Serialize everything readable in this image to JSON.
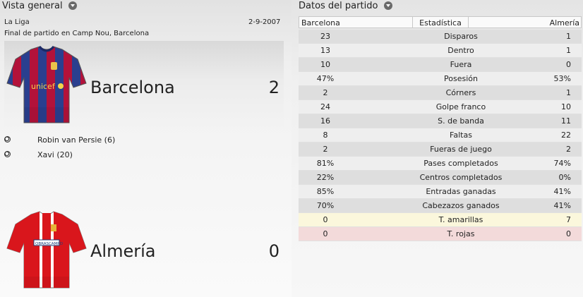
{
  "overview": {
    "header": "Vista general",
    "competition": "La Liga",
    "date": "2-9-2007",
    "venue_line": "Final de partido en Camp Nou, Barcelona",
    "home": {
      "name": "Barcelona",
      "score": "2",
      "kit_sponsor": "unicef",
      "scorers": [
        "Robin van Persie (6)",
        "Xavi (20)"
      ]
    },
    "away": {
      "name": "Almería",
      "score": "0",
      "kit_sponsor": "OBRASCAMPO"
    }
  },
  "stats": {
    "header": "Datos del partido",
    "columns": [
      "Barcelona",
      "Estadística",
      "Almería"
    ],
    "rows": [
      {
        "home": "23",
        "label": "Disparos",
        "away": "1"
      },
      {
        "home": "13",
        "label": "Dentro",
        "away": "1"
      },
      {
        "home": "10",
        "label": "Fuera",
        "away": "0"
      },
      {
        "home": "47%",
        "label": "Posesión",
        "away": "53%"
      },
      {
        "home": "2",
        "label": "Córners",
        "away": "1"
      },
      {
        "home": "24",
        "label": "Golpe franco",
        "away": "10"
      },
      {
        "home": "16",
        "label": "S. de banda",
        "away": "11"
      },
      {
        "home": "8",
        "label": "Faltas",
        "away": "22"
      },
      {
        "home": "2",
        "label": "Fueras de juego",
        "away": "2"
      },
      {
        "home": "81%",
        "label": "Pases completados",
        "away": "74%"
      },
      {
        "home": "22%",
        "label": "Centros completados",
        "away": "0%"
      },
      {
        "home": "85%",
        "label": "Entradas ganadas",
        "away": "41%"
      },
      {
        "home": "70%",
        "label": "Cabezazos ganados",
        "away": "41%"
      },
      {
        "home": "0",
        "label": "T. amarillas",
        "away": "7"
      },
      {
        "home": "0",
        "label": "T. rojas",
        "away": "0"
      }
    ]
  },
  "colors": {
    "yellow_row": "#fbf7dc",
    "red_row": "#f3dada",
    "barca_blue": "#2a3f8f",
    "barca_red": "#b3123a",
    "almeria_red": "#d9161c"
  }
}
